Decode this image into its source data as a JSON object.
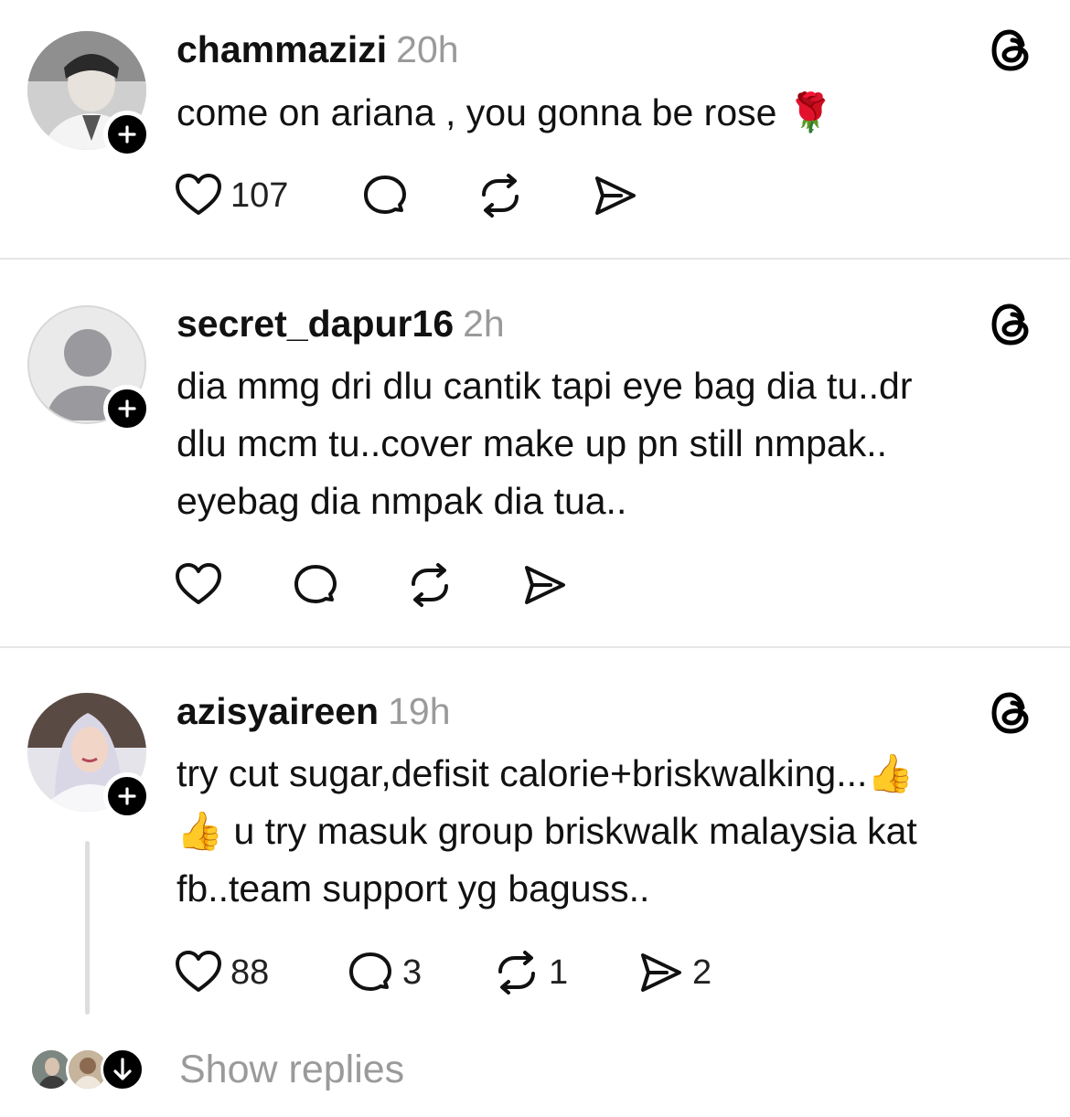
{
  "posts": [
    {
      "username": "chammazizi",
      "time": "20h",
      "lines": [
        "come on ariana , you gonna be rose 🌹"
      ],
      "likes": "107",
      "replies": "",
      "reposts": "",
      "shares": ""
    },
    {
      "username": "secret_dapur16",
      "time": "2h",
      "lines": [
        "dia mmg dri dlu cantik tapi eye bag dia tu..dr",
        "dlu mcm tu..cover make up pn still nmpak..",
        "eyebag dia nmpak dia tua.."
      ],
      "likes": "",
      "replies": "",
      "reposts": "",
      "shares": ""
    },
    {
      "username": "azisyaireen",
      "time": "19h",
      "lines": [
        "try cut sugar,defisit calorie+briskwalking...👍",
        "👍 u try masuk group briskwalk malaysia kat",
        "fb..team support yg baguss.."
      ],
      "likes": "88",
      "replies": "3",
      "reposts": "1",
      "shares": "2"
    }
  ],
  "show_replies_label": "Show replies",
  "colors": {
    "text": "#111111",
    "muted": "#9a9a9a",
    "divider": "#e6e6e6",
    "badge": "#000000"
  }
}
